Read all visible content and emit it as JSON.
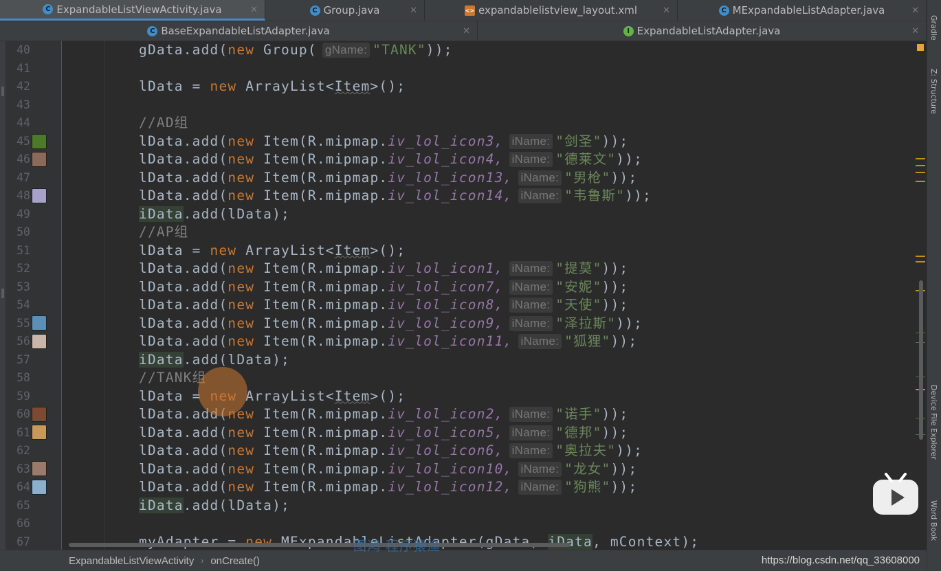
{
  "tabs_row1": [
    {
      "label": "ExpandableListViewActivity.java",
      "icon": "java-class-icon",
      "active": true
    },
    {
      "label": "Group.java",
      "icon": "java-class-icon",
      "active": false
    },
    {
      "label": "expandablelistview_layout.xml",
      "icon": "xml-file-icon",
      "active": false
    },
    {
      "label": "MExpandableListAdapter.java",
      "icon": "java-class-icon",
      "active": false
    }
  ],
  "tabs_row2": [
    {
      "label": "BaseExpandableListAdapter.java",
      "icon": "java-class-icon",
      "active": false
    },
    {
      "label": "ExpandableListAdapter.java",
      "icon": "java-interface-icon",
      "active": false
    }
  ],
  "close_glyph": "×",
  "right_tools": [
    "Gradle",
    "Z: Structure",
    "Device File Explorer",
    "Word Book"
  ],
  "code": {
    "line_numbers": [
      "40",
      "41",
      "42",
      "43",
      "44",
      "45",
      "46",
      "47",
      "48",
      "49",
      "50",
      "51",
      "52",
      "53",
      "54",
      "55",
      "56",
      "57",
      "58",
      "59",
      "60",
      "61",
      "62",
      "63",
      "64",
      "65",
      "66",
      "67"
    ],
    "l40": {
      "a": "gData.add(",
      "kw": "new",
      "b": " Group(",
      "hint": "gName:",
      "str": "\"TANK\"",
      "c": "));"
    },
    "l42": {
      "a": "lData = ",
      "kw": "new",
      "b": " ArrayList<",
      "item": "Item",
      "c": ">();"
    },
    "l44": "//AD组",
    "l49": {
      "a": "iData",
      "b": ".add(lData);"
    },
    "l50": "//AP组",
    "l51": {
      "a": "lData = ",
      "kw": "new",
      "b": " ArrayList<",
      "item": "Item",
      "c": ">();"
    },
    "l57": {
      "a": "iData",
      "b": ".add(lData);"
    },
    "l58": "//TANK组",
    "l59": {
      "a": "lData = ",
      "kw": "new",
      "b": " ArrayList<",
      "item": "Item",
      "c": ">();"
    },
    "l65": {
      "a": "iData",
      "b": ".add(lData);"
    },
    "l67": {
      "a": "myAdapter = ",
      "kw": "new",
      "b": " MExpandableListAdapter(gData, ",
      "id": "iData",
      "c": ", mContext);"
    },
    "item_calls": [
      {
        "line": "45",
        "icon": "iv_lol_icon3",
        "name": "\"剑圣\""
      },
      {
        "line": "46",
        "icon": "iv_lol_icon4",
        "name": "\"德莱文\""
      },
      {
        "line": "47",
        "icon": "iv_lol_icon13",
        "name": "\"男枪\""
      },
      {
        "line": "48",
        "icon": "iv_lol_icon14",
        "name": "\"韦鲁斯\""
      },
      {
        "line": "52",
        "icon": "iv_lol_icon1",
        "name": "\"提莫\""
      },
      {
        "line": "53",
        "icon": "iv_lol_icon7",
        "name": "\"安妮\""
      },
      {
        "line": "54",
        "icon": "iv_lol_icon8",
        "name": "\"天使\""
      },
      {
        "line": "55",
        "icon": "iv_lol_icon9",
        "name": "\"泽拉斯\""
      },
      {
        "line": "56",
        "icon": "iv_lol_icon11",
        "name": "\"狐狸\""
      },
      {
        "line": "60",
        "icon": "iv_lol_icon2",
        "name": "\"诺手\""
      },
      {
        "line": "61",
        "icon": "iv_lol_icon5",
        "name": "\"德邦\""
      },
      {
        "line": "62",
        "icon": "iv_lol_icon6",
        "name": "\"奥拉夫\""
      },
      {
        "line": "63",
        "icon": "iv_lol_icon10",
        "name": "\"龙女\""
      },
      {
        "line": "64",
        "icon": "iv_lol_icon12",
        "name": "\"狗熊\""
      }
    ],
    "item_prefix": "lData.add(",
    "item_new": "new",
    "item_mid": " Item(R.mipmap.",
    "item_hint": "iName:",
    "item_end": "));"
  },
  "gutter_thumbs": [
    {
      "line": "45",
      "color": "#4d7a2a"
    },
    {
      "line": "46",
      "color": "#8a6a58"
    },
    {
      "line": "48",
      "color": "#a7a0c8"
    },
    {
      "line": "55",
      "color": "#5d8fb5"
    },
    {
      "line": "56",
      "color": "#c9b6a6"
    },
    {
      "line": "60",
      "color": "#7a4a32"
    },
    {
      "line": "61",
      "color": "#c79a5a"
    },
    {
      "line": "63",
      "color": "#9a7a6a"
    },
    {
      "line": "64",
      "color": "#8ab0cc"
    }
  ],
  "breadcrumb": {
    "class": "ExpandableListViewActivity",
    "sep": "›",
    "method": "onCreate()"
  },
  "watermark_url": "https://blog.csdn.net/qq_33608000",
  "subtitle_overlay": "图鸿 程序猿渔",
  "colors": {
    "keyword": "#cc7832",
    "field": "#9876aa",
    "string": "#6a8759",
    "comment": "#808080",
    "background": "#2b2b2b"
  }
}
